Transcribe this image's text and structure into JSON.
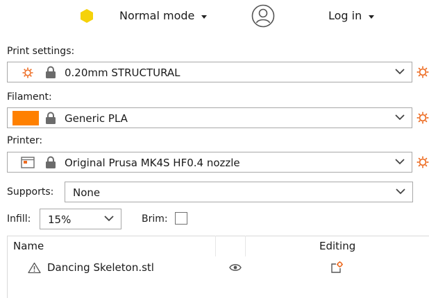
{
  "topbar": {
    "mode_label": "Normal mode",
    "login_label": "Log in",
    "mode_color": "#f5d20a"
  },
  "print_settings": {
    "label": "Print settings:",
    "value": "0.20mm STRUCTURAL"
  },
  "filament": {
    "label": "Filament:",
    "value": "Generic PLA",
    "color": "#ff8000"
  },
  "printer": {
    "label": "Printer:",
    "value": "Original Prusa MK4S HF0.4 nozzle"
  },
  "supports": {
    "label": "Supports:",
    "value": "None"
  },
  "infill": {
    "label": "Infill:",
    "value": "15%"
  },
  "brim": {
    "label": "Brim:",
    "checked": false
  },
  "object_list": {
    "columns": [
      "Name",
      "",
      "Editing"
    ],
    "rows": [
      {
        "name": "Dancing Skeleton.stl"
      }
    ]
  },
  "colors": {
    "accent_orange": "#ed6b21",
    "border": "#a8a8a8"
  }
}
